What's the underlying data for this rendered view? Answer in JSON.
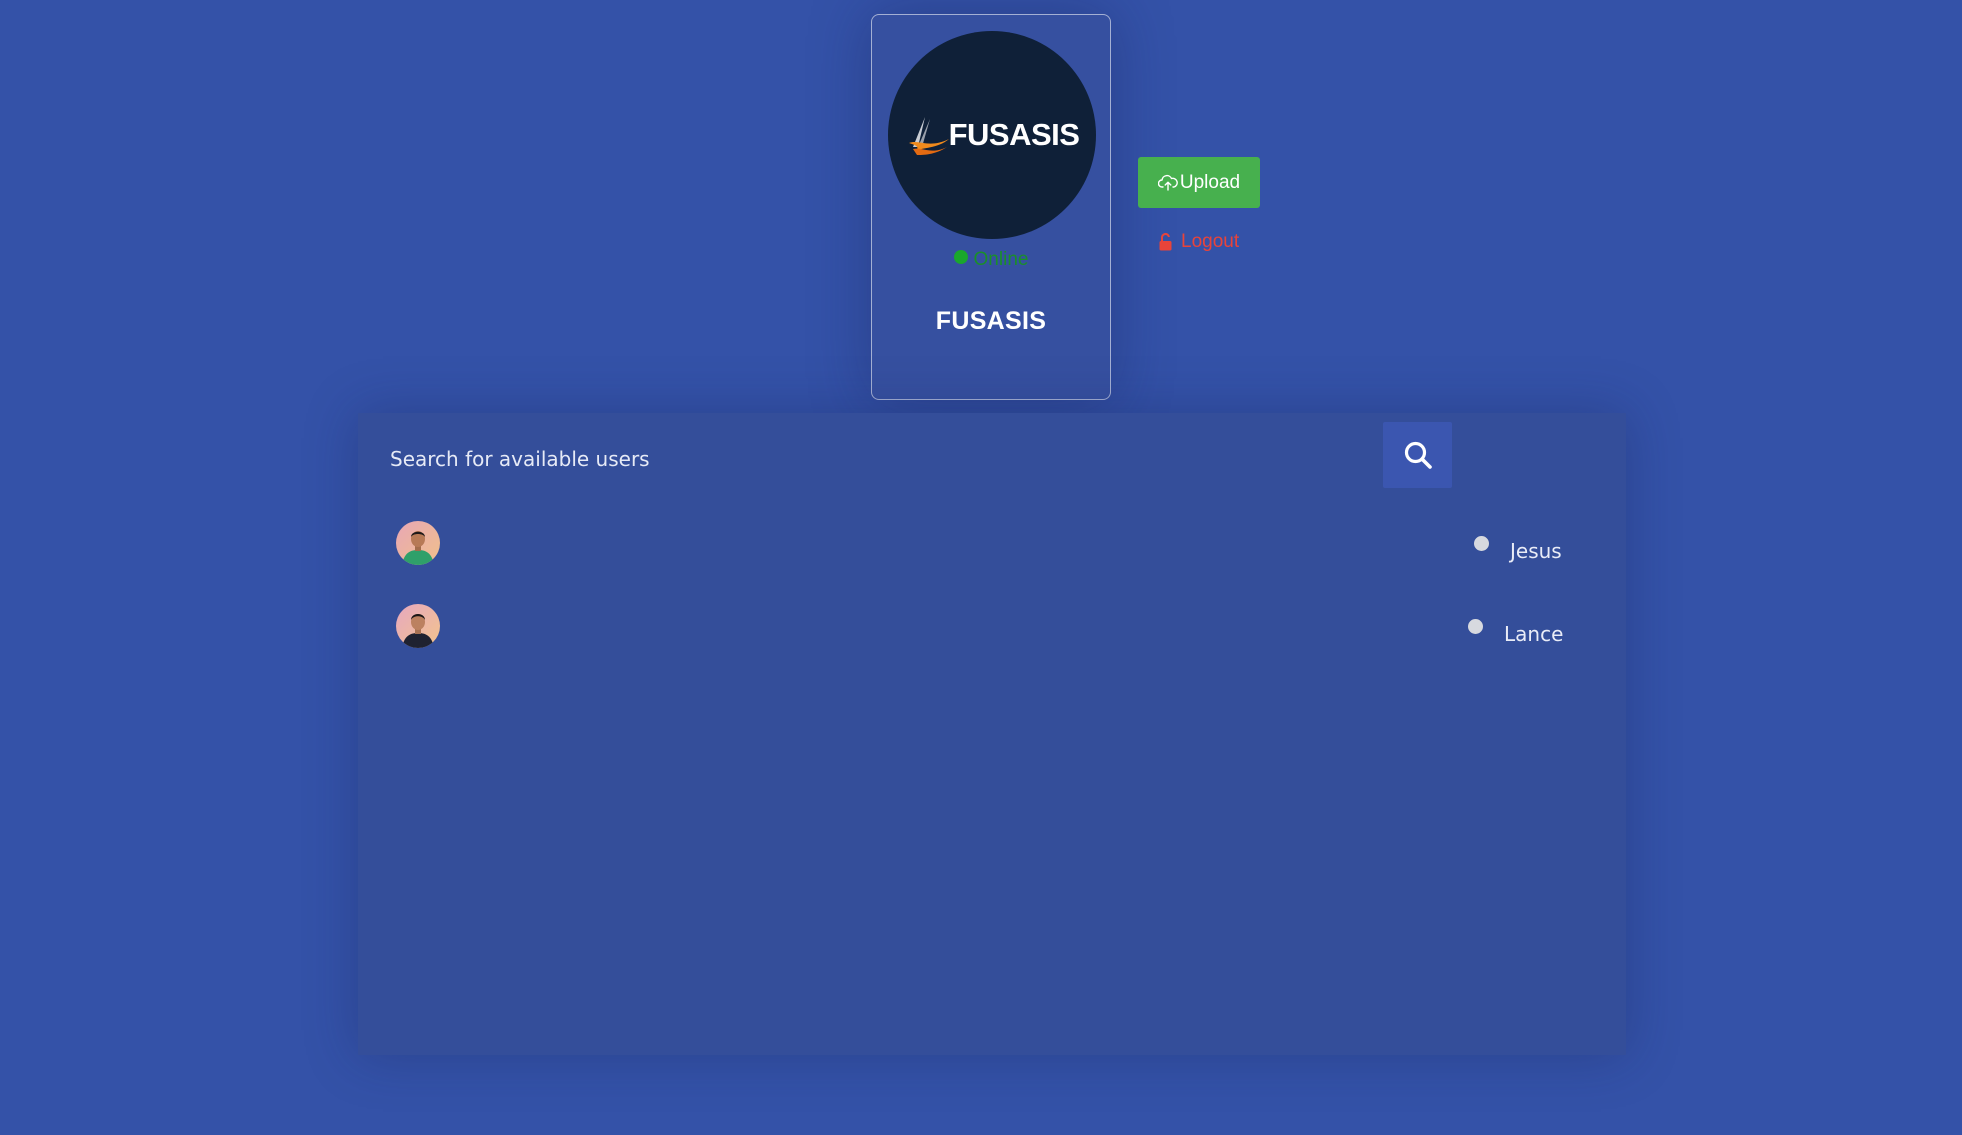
{
  "profile": {
    "logo_text": "FUSASIS",
    "status_label": "Online",
    "status_color": "#1aa72c",
    "name": "FUSASIS"
  },
  "actions": {
    "upload_label": "Upload",
    "upload_icon": "cloud-upload-icon",
    "logout_label": "Logout",
    "logout_icon": "unlock-icon"
  },
  "search": {
    "placeholder": "Search for available users",
    "button_icon": "search-icon"
  },
  "users": [
    {
      "name": "Jesus",
      "presence": "offline",
      "avatar": "user-avatar-photo"
    },
    {
      "name": "Lance",
      "presence": "offline",
      "avatar": "user-avatar-photo"
    }
  ],
  "colors": {
    "background": "#3452a8",
    "panel": "#344e9a",
    "upload_button": "#47b04e",
    "logout_text": "#e8443a",
    "search_button": "#3b56b0",
    "presence_offline": "#d7d9df"
  }
}
